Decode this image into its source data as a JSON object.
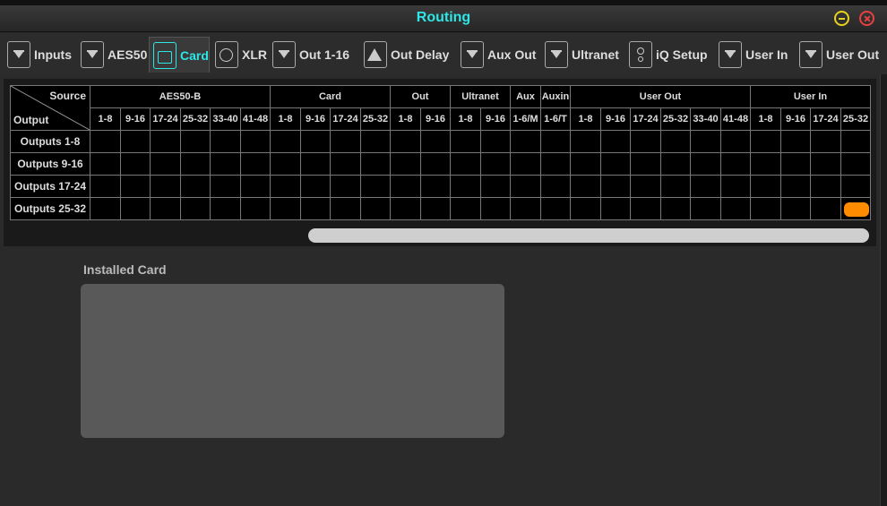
{
  "window": {
    "title": "Routing"
  },
  "tabs": [
    {
      "label": "Inputs",
      "icon": "in",
      "active": false
    },
    {
      "label": "AES50",
      "icon": "out",
      "active": false
    },
    {
      "label": "Card",
      "icon": "card",
      "active": true
    },
    {
      "label": "XLR",
      "icon": "xlr",
      "active": false
    },
    {
      "label": "Out 1-16",
      "icon": "out",
      "active": false
    },
    {
      "label": "Out Delay",
      "icon": "delay",
      "active": false
    },
    {
      "label": "Aux Out",
      "icon": "out",
      "active": false
    },
    {
      "label": "Ultranet",
      "icon": "out",
      "active": false
    },
    {
      "label": "iQ Setup",
      "icon": "speaker",
      "active": false
    },
    {
      "label": "User In",
      "icon": "in",
      "active": false
    },
    {
      "label": "User Out",
      "icon": "out",
      "active": false
    }
  ],
  "matrix": {
    "corner_source": "Source",
    "corner_output": "Output",
    "groups": [
      {
        "name": "AES50-B",
        "span": 6
      },
      {
        "name": "Card",
        "span": 4
      },
      {
        "name": "Out",
        "span": 2
      },
      {
        "name": "Ultranet",
        "span": 2
      },
      {
        "name": "Aux",
        "span": 1
      },
      {
        "name": "Auxin",
        "span": 1
      },
      {
        "name": "User Out",
        "span": 6
      },
      {
        "name": "User In",
        "span": 4
      }
    ],
    "columns": [
      "1-8",
      "9-16",
      "17-24",
      "25-32",
      "33-40",
      "41-48",
      "1-8",
      "9-16",
      "17-24",
      "25-32",
      "1-8",
      "9-16",
      "1-8",
      "9-16",
      "1-6/M",
      "1-6/T",
      "1-8",
      "9-16",
      "17-24",
      "25-32",
      "33-40",
      "41-48",
      "1-8",
      "9-16",
      "17-24",
      "25-32"
    ],
    "rows": [
      "Outputs 1-8",
      "Outputs 9-16",
      "Outputs 17-24",
      "Outputs 25-32"
    ],
    "active_cells": [
      [
        3,
        25
      ]
    ],
    "active_color": "#ff8c00"
  },
  "installed_card": {
    "label": "Installed Card"
  },
  "colors": {
    "accent": "#2ee6e6",
    "close": "#e84040",
    "minimize": "#e8d21a"
  }
}
